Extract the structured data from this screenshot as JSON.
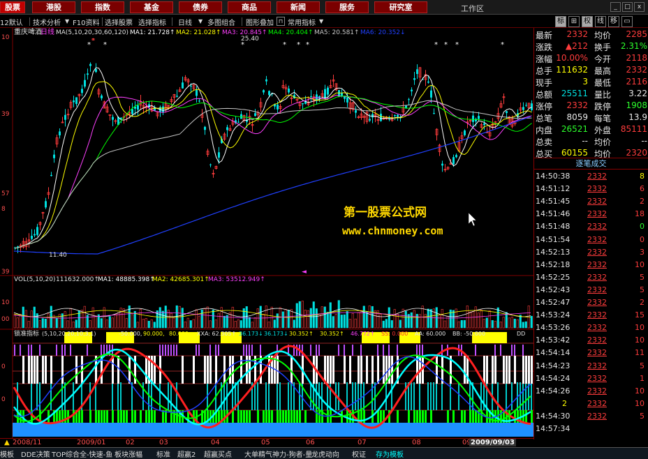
{
  "nav": {
    "left_label": "股票",
    "buttons": [
      "港股",
      "指数",
      "基金",
      "债券",
      "商品",
      "新闻",
      "服务",
      "研究室"
    ],
    "work_area": "工作区",
    "window_controls": [
      "_",
      "□",
      "x"
    ]
  },
  "toolbar": {
    "items": [
      "12默认",
      "技术分析",
      "F10资料",
      "选择股票",
      "选择指标",
      "日线",
      "多图组合",
      "图形叠加",
      "常用指标"
    ],
    "right_tabs": [
      "标",
      "⊞",
      "权",
      "线",
      "移",
      "▭"
    ]
  },
  "main_chart": {
    "stock_name": "重庆啤酒",
    "period": "日线",
    "ma_params": "MA(5,10,20,30,60,120)",
    "ma_labels": [
      "MA1: 21.728↑",
      "MA2: 21.028↑",
      "MA3: 20.845↑",
      "MA4: 20.404↑",
      "MA5: 20.581↑",
      "MA6: 20.352↓"
    ],
    "price_max_label": "25.40",
    "price_min_label": "11.40",
    "axis_labels": [
      "10",
      "39",
      "57",
      "8",
      "39"
    ],
    "watermark_title": "第一股票公式网",
    "watermark_url": "www.chnmoney.com",
    "stars": [
      "*",
      "*",
      "*",
      "*",
      "*",
      "*",
      "*",
      "*",
      "*",
      "*"
    ]
  },
  "volume_panel": {
    "label": "VOL(5,10,20)",
    "value": "111632.000↑",
    "ma_labels": [
      "MA1: 48885.398↑",
      "MA2: 42685.301↑",
      "MA3: 53512.949↑"
    ],
    "axis_labels": [
      "10",
      "00"
    ]
  },
  "indicator_panel": {
    "name": "锁准指标",
    "params": "(5,10,20,20,10,3,1)",
    "values": [
      "-50.000,",
      "90.000,",
      "80.000",
      "XXA: 62.305↑",
      "36.173↓",
      "36.173↓",
      "30.352↑",
      "30.352↑",
      "46.772↑",
      "SS: 0.000",
      "AA: 60.000",
      "BB: -50.000",
      "DD"
    ],
    "axis_labels": [
      "0",
      "0"
    ]
  },
  "dates": {
    "labels": [
      "2008/11",
      "2009/01",
      "02",
      "03",
      "04",
      "05",
      "06",
      "07",
      "08",
      "09"
    ],
    "current": "2009/09/03"
  },
  "quote": {
    "rows": [
      {
        "l1": "最新",
        "v1": "2332",
        "l2": "均价",
        "v2": "2285"
      },
      {
        "l1": "涨跌",
        "v1": "▲212",
        "l2": "换手",
        "v2": "2.31%"
      },
      {
        "l1": "涨幅",
        "v1": "10.00%",
        "l2": "今开",
        "v2": "2118"
      },
      {
        "l1": "总手",
        "v1": "111632",
        "l2": "最高",
        "v2": "2332"
      },
      {
        "l1": "现手",
        "v1": "3",
        "l2": "最低",
        "v2": "2116"
      },
      {
        "l1": "总额",
        "v1": "25511",
        "l2": "量比",
        "v2": "3.22"
      },
      {
        "l1": "涨停",
        "v1": "2332",
        "l2": "跌停",
        "v2": "1908"
      },
      {
        "l1": "总笔",
        "v1": "8059",
        "l2": "每笔",
        "v2": "13.9"
      },
      {
        "l1": "内盘",
        "v1": "26521",
        "l2": "外盘",
        "v2": "85111"
      },
      {
        "l1": "总卖",
        "v1": "--",
        "l2": "均价",
        "v2": "--"
      },
      {
        "l1": "总买",
        "v1": "60155",
        "l2": "均价",
        "v2": "2320"
      }
    ]
  },
  "trades": {
    "header": "逐笔成交",
    "rows": [
      {
        "t": "14:50:38",
        "p": "2332",
        "v": "8"
      },
      {
        "t": "14:51:12",
        "p": "2332",
        "v": "6"
      },
      {
        "t": "14:51:45",
        "p": "2332",
        "v": "2"
      },
      {
        "t": "14:51:46",
        "p": "2332",
        "v": "18"
      },
      {
        "t": "14:51:48",
        "p": "2332",
        "v": "0"
      },
      {
        "t": "14:51:54",
        "p": "2332",
        "v": "0"
      },
      {
        "t": "14:52:13",
        "p": "2332",
        "v": "3"
      },
      {
        "t": "14:52:18",
        "p": "2332",
        "v": "10"
      },
      {
        "t": "14:52:25",
        "p": "2332",
        "v": "5"
      },
      {
        "t": "14:52:43",
        "p": "2332",
        "v": "5"
      },
      {
        "t": "14:52:47",
        "p": "2332",
        "v": "2"
      },
      {
        "t": "14:53:24",
        "p": "2332",
        "v": "15"
      },
      {
        "t": "14:53:26",
        "p": "2332",
        "v": "10"
      },
      {
        "t": "14:53:42",
        "p": "2332",
        "v": "10"
      },
      {
        "t": "14:54:14",
        "p": "2332",
        "v": "11"
      },
      {
        "t": "14:54:23",
        "p": "2332",
        "v": "5"
      },
      {
        "t": "14:54:24",
        "p": "2332",
        "v": "1"
      },
      {
        "t": "14:54:26",
        "p": "2332",
        "v": "10"
      },
      {
        "t": "2",
        "p": "2332",
        "v": "10"
      },
      {
        "t": "14:54:30",
        "p": "2332",
        "v": "5"
      }
    ],
    "last_row": "14:57:34"
  },
  "bottom": {
    "tabs": [
      "模板",
      "DDE决策",
      "TOP综合",
      "全-快速-鱼",
      "板块涨幅",
      "标准",
      "超赢2",
      "超赢买点",
      "大单精气神力-狗者-量",
      "龙虎动向",
      "权证",
      "存为模板"
    ],
    "active": "存为模板"
  },
  "colors": {
    "up": "#ff3c3c",
    "down": "#00e0e0",
    "ma1": "#ffffff",
    "ma2": "#ffff00",
    "ma3": "#ff40ff",
    "ma4": "#00ff00",
    "ma5": "#c8c8c8",
    "ma6": "#2040ff",
    "bg": "#000000",
    "border": "#800000"
  }
}
